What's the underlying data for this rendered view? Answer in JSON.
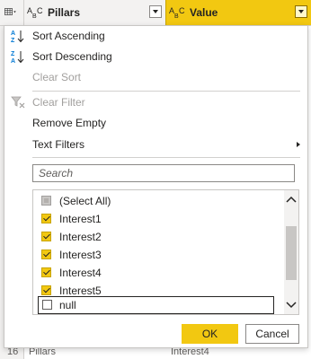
{
  "header": {
    "pillars_label": "Pillars",
    "value_label": "Value",
    "type_icon_text": "ABC",
    "type_icon_sub": "C"
  },
  "bottom_row": {
    "row_number": "16",
    "pillars_cell": "Pillars",
    "value_cell": "Interest4"
  },
  "menu": {
    "sort_ascending": "Sort Ascending",
    "sort_descending": "Sort Descending",
    "clear_sort": "Clear Sort",
    "clear_filter": "Clear Filter",
    "remove_empty": "Remove Empty",
    "text_filters": "Text Filters",
    "search_placeholder": "Search",
    "sort_asc_icon": "sort-ascending-icon",
    "sort_desc_icon": "sort-descending-icon",
    "clear_filter_icon": "clear-filter-icon"
  },
  "filter_list": {
    "items": [
      {
        "label": "(Select All)",
        "state": "partial"
      },
      {
        "label": "Interest1",
        "state": "checked"
      },
      {
        "label": "Interest2",
        "state": "checked"
      },
      {
        "label": "Interest3",
        "state": "checked"
      },
      {
        "label": "Interest4",
        "state": "checked"
      },
      {
        "label": "Interest5",
        "state": "checked"
      },
      {
        "label": "null",
        "state": "unchecked"
      }
    ]
  },
  "buttons": {
    "ok": "OK",
    "cancel": "Cancel"
  },
  "colors": {
    "accent": "#f2c811",
    "disabled_text": "#a19f9d",
    "sort_icon": "#0078d4"
  }
}
